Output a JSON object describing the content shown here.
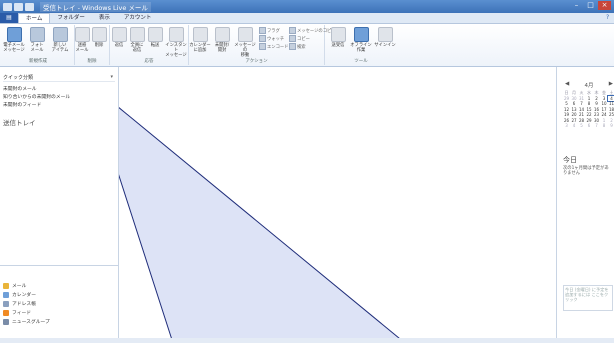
{
  "window": {
    "title": "受信トレイ - Windows Live メール",
    "controls": [
      "–",
      "□",
      "×"
    ]
  },
  "tabs": {
    "file": "▤",
    "items": [
      "ホーム",
      "フォルダー",
      "表示",
      "アカウント"
    ],
    "active_index": 0,
    "help": "?"
  },
  "ribbon": {
    "new_group": {
      "label": "新規作成",
      "buttons": [
        {
          "label": "電子メール\nメッセージ",
          "icon": "new-mail-icon"
        },
        {
          "label": "フォト\nメール",
          "icon": "photo-mail-icon"
        },
        {
          "label": "新しい\nアイテム",
          "icon": "new-items-icon"
        }
      ]
    },
    "delete_group": {
      "label": "削除",
      "buttons": [
        {
          "label": "迷惑\nメール",
          "icon": "junk-icon"
        },
        {
          "label": "削除",
          "icon": "delete-icon"
        }
      ]
    },
    "respond_group": {
      "label": "応答",
      "buttons": [
        {
          "label": "返信",
          "icon": "reply-icon"
        },
        {
          "label": "全員に\n返信",
          "icon": "reply-all-icon"
        },
        {
          "label": "転送",
          "icon": "forward-icon"
        },
        {
          "label": "インスタント\nメッセージ",
          "icon": "im-icon"
        }
      ]
    },
    "actions_group": {
      "label": "アクション",
      "buttons": [
        {
          "label": "カレンダー\nに追加",
          "icon": "calendar-add-icon"
        },
        {
          "label": "未開封/\n開封",
          "icon": "read-unread-icon"
        },
        {
          "label": "メッセージの\n移動",
          "icon": "move-icon"
        }
      ],
      "small": [
        "フラグ",
        "ウォッチ",
        "エンコード",
        "メッセージのコピー",
        "コピー",
        "検索"
      ]
    },
    "tools_group": {
      "label": "ツール",
      "buttons": [
        {
          "label": "送受信",
          "icon": "send-receive-icon"
        },
        {
          "label": "オフライン\n作業",
          "icon": "offline-icon"
        },
        {
          "label": "サインイン",
          "icon": "signin-icon"
        }
      ]
    }
  },
  "left_pane": {
    "quick_views_title": "クイック分類",
    "quick_views": [
      "未開封のメール",
      "知り合いからの未開封のメール",
      "未開封のフィード"
    ],
    "outbox": "送信トレイ",
    "bottom_nav": [
      {
        "label": "メール",
        "icon": "mail-icon",
        "color": "#e9b43a"
      },
      {
        "label": "カレンダー",
        "icon": "calendar-icon",
        "color": "#6f9fd8"
      },
      {
        "label": "アドレス帳",
        "icon": "contacts-icon",
        "color": "#8aa0bf"
      },
      {
        "label": "フィード",
        "icon": "feed-icon",
        "color": "#f08a24"
      },
      {
        "label": "ニュースグループ",
        "icon": "newsgroup-icon",
        "color": "#7a8ca8"
      }
    ]
  },
  "calendar": {
    "month": "4月",
    "prev": "◀",
    "next": "▶",
    "rows": [
      [
        "日",
        "月",
        "火",
        "水",
        "木",
        "金",
        "土"
      ],
      [
        "29",
        "30",
        "31",
        "1",
        "2",
        "3",
        "4"
      ],
      [
        "5",
        "6",
        "7",
        "8",
        "9",
        "10",
        "11"
      ],
      [
        "12",
        "13",
        "14",
        "15",
        "16",
        "17",
        "18"
      ],
      [
        "19",
        "20",
        "21",
        "22",
        "23",
        "24",
        "25"
      ],
      [
        "26",
        "27",
        "28",
        "29",
        "30",
        "1",
        "2"
      ],
      [
        "3",
        "4",
        "5",
        "6",
        "7",
        "8",
        "9"
      ]
    ],
    "today_label": "今日",
    "today_text": "次の1ヶ月間は予定があ りません",
    "todo_text": "今日 (金曜日) に予定を追加するには ここをクリック"
  },
  "colors": {
    "accent": "#3a6bb5",
    "titlebar": "#3d72b8",
    "arrow_fill": "#dde3f6"
  }
}
